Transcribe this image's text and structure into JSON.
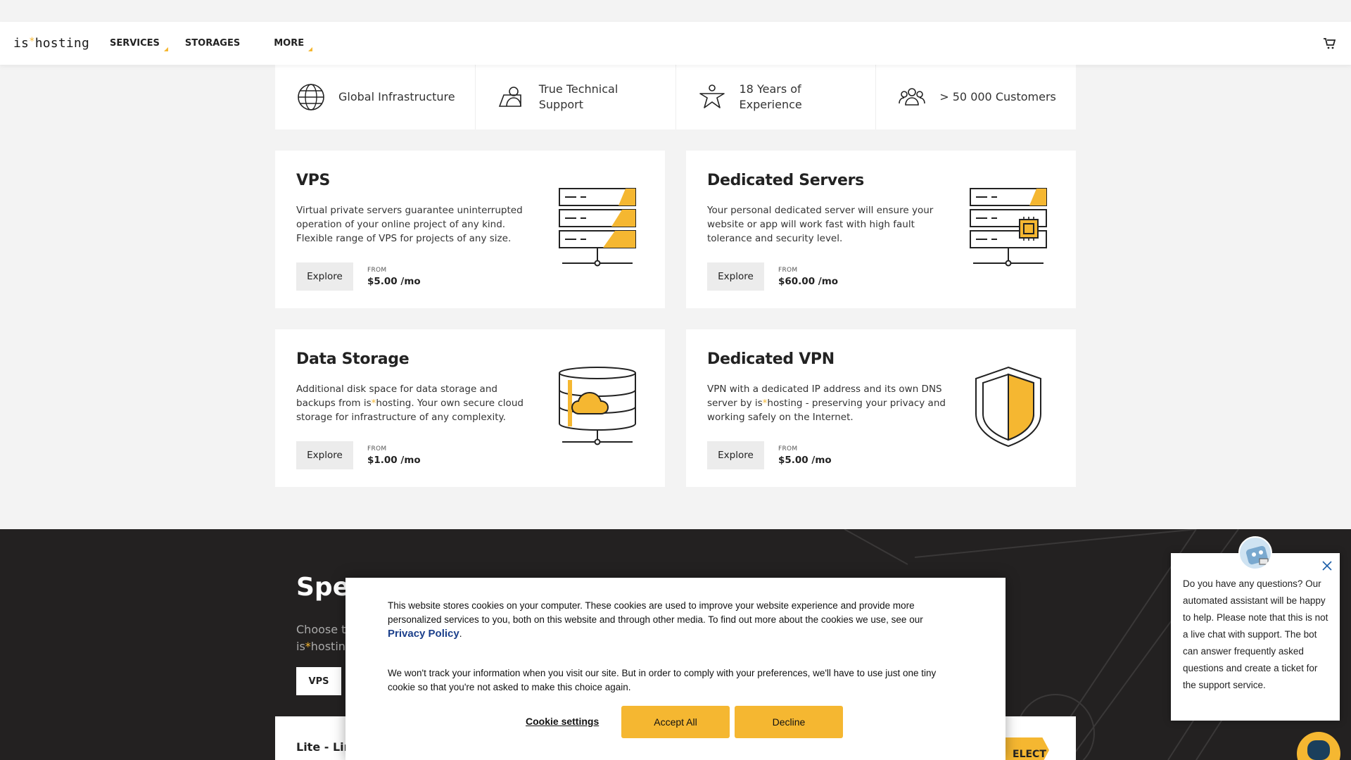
{
  "header": {
    "logo_prefix": "is",
    "logo_star": "*",
    "logo_suffix": "hosting",
    "nav": [
      "SERVICES",
      "STORAGES",
      "MORE"
    ],
    "cart_icon": "cart-icon"
  },
  "features": [
    {
      "icon": "globe-icon",
      "text": "Global Infrastructure"
    },
    {
      "icon": "support-icon",
      "text": "True Technical Support"
    },
    {
      "icon": "person-icon",
      "text": "18 Years of Experience"
    },
    {
      "icon": "customers-icon",
      "text": "> 50 000 Customers"
    }
  ],
  "cards": [
    {
      "title": "VPS",
      "desc": "Virtual private servers guarantee uninterrupted operation of your online project of any kind. Flexible range of VPS for projects of any size.",
      "button": "Explore",
      "from": "FROM",
      "price": "$5.00 /mo"
    },
    {
      "title": "Dedicated Servers",
      "desc": "Your personal dedicated server will ensure your website or app will work fast with high fault tolerance and security level.",
      "button": "Explore",
      "from": "FROM",
      "price": "$60.00 /mo"
    },
    {
      "title": "Data Storage",
      "desc_a": "Additional disk space for data storage and backups from is",
      "desc_star": "*",
      "desc_b": "hosting. Your own secure cloud storage for infrastructure of any complexity.",
      "button": "Explore",
      "from": "FROM",
      "price": "$1.00 /mo"
    },
    {
      "title": "Dedicated VPN",
      "desc_a": "VPN with a dedicated IP address and its own DNS server by is",
      "desc_star": "*",
      "desc_b": "hosting - preserving your privacy and working safely on the Internet.",
      "button": "Explore",
      "from": "FROM",
      "price": "$5.00 /mo"
    }
  ],
  "dark": {
    "title": "Spe",
    "sub_line1": "Choose th",
    "sub_line2_a": "is",
    "sub_line2_star": "*",
    "sub_line2_b": "hosting",
    "tab": "VPS",
    "plan_name": "Lite - Lin",
    "select": "ELECT"
  },
  "cookie": {
    "text1": "This website stores cookies on your computer. These cookies are used to improve your website experience and provide more personalized services to you, both on this website and through other media. To find out more about the cookies we use, see our",
    "link": "Privacy Policy",
    "text1_end": ".",
    "text2": "We won't track your information when you visit our site. But in order to comply with your preferences, we'll have to use just one tiny cookie so that you're not asked to make this choice again.",
    "settings": "Cookie settings",
    "accept": "Accept All",
    "decline": "Decline"
  },
  "chat": {
    "message": "Do you have any questions? Our automated assistant will be happy to help. Please note that this is not a live chat with support. The bot can answer frequently asked questions and create a ticket for the support service."
  },
  "colors": {
    "accent": "#f5b731",
    "dark_bg": "#232121",
    "link": "#1b3f8b"
  }
}
